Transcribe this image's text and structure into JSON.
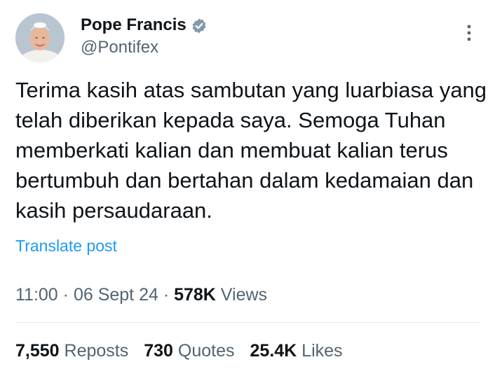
{
  "author": {
    "display_name": "Pope Francis",
    "handle": "@Pontifex",
    "verified": true,
    "avatar_icon": "pope-portrait-avatar"
  },
  "icons": {
    "verified": "verified-badge-icon",
    "more": "more-options-icon"
  },
  "tweet": {
    "text": "Terima kasih atas sambutan yang luarbiasa yang telah diberikan kepada saya. Semoga Tuhan memberkati kalian dan membuat kalian terus bertumbuh dan bertahan dalam kedamaian dan kasih persaudaraan.",
    "translate_label": "Translate post"
  },
  "meta": {
    "time": "11:00",
    "sep1": " · ",
    "date": "06 Sept 24",
    "sep2": " · ",
    "views_count": "578K",
    "views_label": " Views"
  },
  "stats": {
    "reposts_count": "7,550",
    "reposts_label": " Reposts",
    "quotes_count": "730",
    "quotes_label": " Quotes",
    "likes_count": "25.4K",
    "likes_label": " Likes"
  },
  "colors": {
    "link": "#1d9bf0",
    "secondary_text": "#536471",
    "primary_text": "#0f1419",
    "verified_badge": "#829aab"
  }
}
